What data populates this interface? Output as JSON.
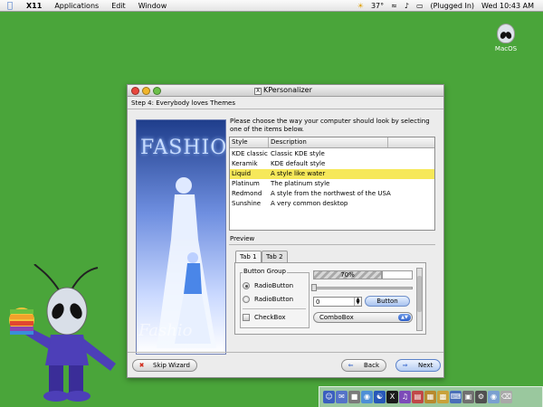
{
  "menubar": {
    "items": [
      "X11",
      "Applications",
      "Edit",
      "Window"
    ],
    "temperature": "37°",
    "battery": "(Plugged In)",
    "clock": "Wed 10:43 AM"
  },
  "desktop": {
    "icon_label": "MacOS"
  },
  "window": {
    "title": "KPersonalizer",
    "step": "Step 4: Everybody loves Themes",
    "prompt": "Please choose the way your computer should look by selecting one of the items below.",
    "image_title": "FASHION",
    "image_caption": "Fashio",
    "list": {
      "headers": [
        "Style",
        "Description"
      ],
      "rows": [
        {
          "style": "KDE classic",
          "desc": "Classic KDE style"
        },
        {
          "style": "Keramik",
          "desc": "KDE default style"
        },
        {
          "style": "Liquid",
          "desc": "A style like water"
        },
        {
          "style": "Platinum",
          "desc": "The platinum style"
        },
        {
          "style": "Redmond",
          "desc": "A style from the northwest of the USA"
        },
        {
          "style": "Sunshine",
          "desc": "A very common desktop"
        }
      ],
      "selected": "Liquid"
    },
    "preview": {
      "label": "Preview",
      "tabs": [
        "Tab 1",
        "Tab 2"
      ],
      "group_label": "Button Group",
      "radio1": "RadioButton",
      "radio2": "RadioButton",
      "checkbox": "CheckBox",
      "progress": "70%",
      "progress_value": 0.7,
      "spin_value": "0",
      "button": "Button",
      "combo": "ComboBox"
    },
    "buttons": {
      "skip": "Skip Wizard",
      "back": "Back",
      "next": "Next"
    }
  },
  "colors": {
    "desktop": "#4aa53a",
    "selection": "#f6e85a",
    "aqua": "#2c5ec9"
  }
}
